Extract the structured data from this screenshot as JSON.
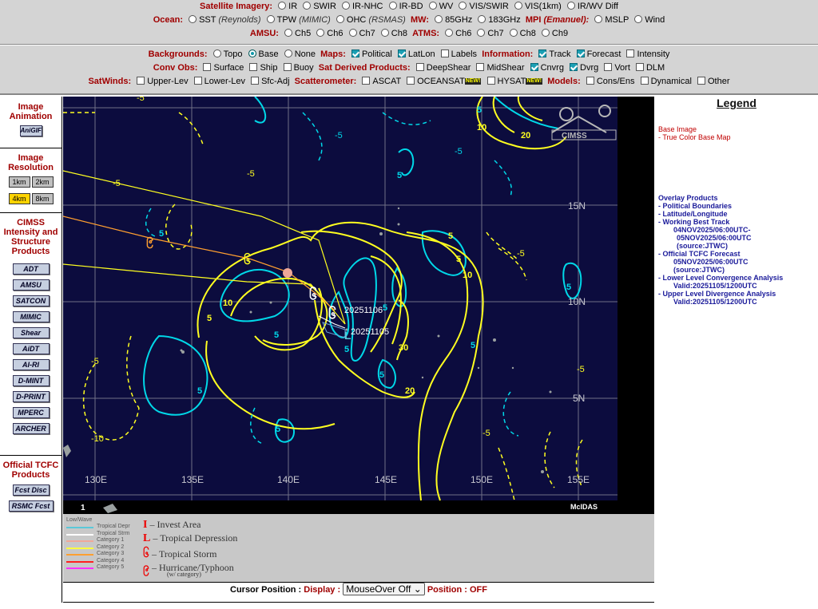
{
  "satellite": {
    "label": "Satellite Imagery:",
    "options": [
      "IR",
      "SWIR",
      "IR-NHC",
      "IR-BD",
      "WV",
      "VIS/SWIR",
      "VIS(1km)",
      "IR/WV Diff"
    ]
  },
  "ocean": {
    "label": "Ocean:",
    "sst": "SST",
    "sst_src": "(Reynolds)",
    "tpw": "TPW",
    "tpw_src": "(MIMIC)",
    "ohc": "OHC",
    "ohc_src": "(RSMAS)",
    "mw_label": "MW:",
    "mw85": "85GHz",
    "mw183": "183GHz",
    "mpi_label": "MPI",
    "mpi_src": "(Emanuel):",
    "mslp": "MSLP",
    "wind": "Wind"
  },
  "amsu": {
    "label": "AMSU:",
    "options": [
      "Ch5",
      "Ch6",
      "Ch7",
      "Ch8"
    ],
    "atms_label": "ATMS:",
    "atms_options": [
      "Ch6",
      "Ch7",
      "Ch8",
      "Ch9"
    ]
  },
  "backgrounds": {
    "label": "Backgrounds:",
    "topo": "Topo",
    "base": "Base",
    "none": "None",
    "maps_label": "Maps:",
    "political": "Political",
    "latlon": "LatLon",
    "labels": "Labels",
    "info_label": "Information:",
    "track": "Track",
    "forecast": "Forecast",
    "intensity": "Intensity"
  },
  "convobs": {
    "label": "Conv Obs:",
    "surface": "Surface",
    "ship": "Ship",
    "buoy": "Buoy",
    "sat_label": "Sat Derived Products:",
    "deepshear": "DeepShear",
    "midshear": "MidShear",
    "cnvrg": "Cnvrg",
    "dvrg": "Dvrg",
    "vort": "Vort",
    "dlm": "DLM"
  },
  "satwinds": {
    "label": "SatWinds:",
    "upper": "Upper-Lev",
    "lower": "Lower-Lev",
    "sfc": "Sfc-Adj",
    "scat_label": "Scatterometer:",
    "ascat": "ASCAT",
    "oceansat": "OCEANSAT",
    "hysat": "HYSAT",
    "new_badge": "NEW!",
    "models_label": "Models:",
    "consens": "Cons/Ens",
    "dynamical": "Dynamical",
    "other": "Other"
  },
  "leftcol": {
    "anim_title": "Image Animation",
    "anigif": "AniGIF",
    "res_title": "Image Resolution",
    "res": [
      "1km",
      "2km",
      "4km",
      "8km"
    ],
    "cimss_title": "CIMSS Intensity and Structure Products",
    "products": [
      "ADT",
      "AMSU",
      "SATCON",
      "MIMIC",
      "Shear",
      "AiDT",
      "AI-RI",
      "D-MINT",
      "D-PRINT",
      "MPERC",
      "ARCHER"
    ],
    "tcfc_title": "Official TCFC Products",
    "tcfc": [
      "Fcst Disc",
      "RSMC Fcst"
    ]
  },
  "map": {
    "lat_labels": [
      "15N",
      "10N",
      "5N"
    ],
    "lon_labels": [
      "130E",
      "135E",
      "140E",
      "145E",
      "150E",
      "155E"
    ],
    "frame": "1",
    "brand": "McIDAS",
    "logo": "CIMSS",
    "storm_labels": [
      "20251106",
      "20251105"
    ],
    "conv_labels": [
      "5",
      "5",
      "5",
      "5",
      "5",
      "5",
      "5",
      "5",
      "5",
      "5",
      "5"
    ],
    "div_labels": [
      "5",
      "5",
      "5",
      "10",
      "10",
      "10",
      "20",
      "20",
      "30"
    ],
    "neg_labels": [
      "-5",
      "-5",
      "-5",
      "-5",
      "-5",
      "-5",
      "-5",
      "-10",
      "-5",
      "-5"
    ]
  },
  "key": {
    "alt": "Low/Wave",
    "cats": [
      "Tropical Depr",
      "Tropical Strm",
      "Category 1",
      "Category 2",
      "Category 3",
      "Category 4",
      "Category 5"
    ],
    "cat_colors": [
      "#5bc8d8",
      "#ffffff",
      "#f0a898",
      "#ffff40",
      "#ff9f30",
      "#ff2020",
      "#ff30ff"
    ],
    "items": [
      "– Invest Area",
      "– Tropical Depression",
      "– Tropical Storm",
      "– Hurricane/Typhoon"
    ],
    "sub": "(w/ category)"
  },
  "cursor": {
    "label": "Cursor Position :",
    "display_label": "Display :",
    "select": "MouseOver Off",
    "position_label": "Position :",
    "position_val": "OFF"
  },
  "legend": {
    "title": "Legend",
    "base_title": "Base Image",
    "base_item": "-  True Color Base Map",
    "overlay_title": "Overlay Products",
    "lines": [
      "-  Political Boundaries",
      "-  Latitude/Longitude",
      "-  Working Best Track",
      "04NOV2025/06:00UTC-",
      "05NOV2025/06:00UTC",
      "(source:JTWC)",
      "-  Official TCFC Forecast",
      "05NOV2025/06:00UTC",
      "(source:JTWC)",
      "-  Lower Level Convergence Analysis",
      "Valid:20251105/1200UTC",
      "-  Upper Level Divergence Analysis",
      "Valid:20251105/1200UTC"
    ]
  },
  "colors": {
    "label_red": "#a00000",
    "ocean": "#0c0c3e",
    "convergence": "#00d8e8",
    "divergence": "#ffff20"
  }
}
